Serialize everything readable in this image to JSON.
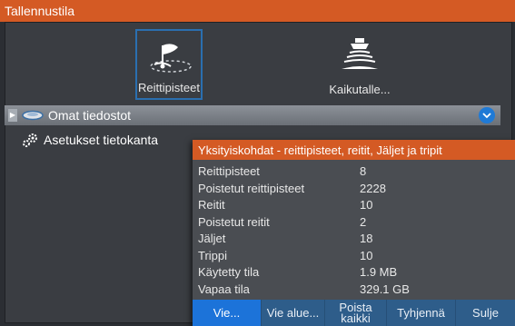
{
  "window": {
    "title": "Tallennustila"
  },
  "icon_bar": {
    "tiles": [
      {
        "label": "Reittipisteet",
        "icon": "flag-waypoint-icon",
        "selected": true
      },
      {
        "label": "Kaikutalle...",
        "icon": "echo-sounder-icon",
        "selected": false
      }
    ]
  },
  "tree": {
    "my_files": {
      "label": "Omat tiedostot",
      "icon": "storage-icon"
    },
    "settings_db": {
      "label": "Asetukset tietokanta",
      "icon": "gears-icon"
    }
  },
  "dialog": {
    "title": "Yksityiskohdat - reittipisteet, reitit, Jäljet ja tripit",
    "rows": [
      {
        "key": "Reittipisteet",
        "value": "8"
      },
      {
        "key": "Poistetut reittipisteet",
        "value": "2228"
      },
      {
        "key": "Reitit",
        "value": "10"
      },
      {
        "key": "Poistetut reitit",
        "value": "2"
      },
      {
        "key": "Jäljet",
        "value": "18"
      },
      {
        "key": "Trippi",
        "value": "10"
      },
      {
        "key": "Käytetty tila",
        "value": "1.9 MB"
      },
      {
        "key": "Vapaa tila",
        "value": "329.1 GB"
      }
    ],
    "buttons": {
      "export": "Vie...",
      "export_area": "Vie alue...",
      "delete_all_1": "Poista",
      "delete_all_2": "kaikki",
      "clear": "Tyhjennä",
      "close": "Sulje"
    }
  },
  "colors": {
    "accent": "#d45a24",
    "primary_button": "#1c73d9",
    "button_bar": "#2e5d8a"
  }
}
